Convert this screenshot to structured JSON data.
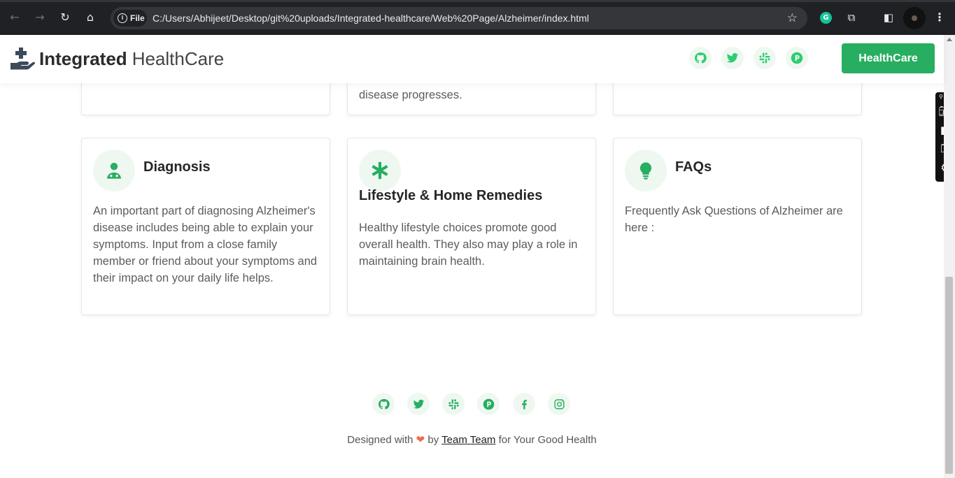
{
  "browser": {
    "file_chip": "File",
    "url": "C:/Users/Abhijeet/Desktop/git%20uploads/Integrated-healthcare/Web%20Page/Alzheimer/index.html",
    "grammarly_letter": "G"
  },
  "header": {
    "brand_bold": "Integrated",
    "brand_light": "HealthCare",
    "social_icons": [
      "github-icon",
      "twitter-icon",
      "slack-icon",
      "product-hunt-icon"
    ],
    "cta_label": "HealthCare",
    "accent_color": "#27ae60"
  },
  "top_cards": {
    "middle_tail_partial": "disease progresses."
  },
  "cards": [
    {
      "icon": "doctor-icon",
      "title": "Diagnosis",
      "text": "An important part of diagnosing Alzheimer's disease includes being able to explain your symptoms. Input from a close family member or friend about your symptoms and their impact on your daily life helps."
    },
    {
      "icon": "asterisk-icon",
      "title": "Lifestyle & Home Remedies",
      "text": "Healthy lifestyle choices promote good overall health. They also may play a role in maintaining brain health."
    },
    {
      "icon": "lightbulb-icon",
      "title": "FAQs",
      "text": "Frequently Ask Questions of Alzheimer are here :"
    }
  ],
  "footer": {
    "social_icons": [
      "github-icon",
      "twitter-icon",
      "slack-icon",
      "product-hunt-icon",
      "facebook-icon",
      "instagram-icon"
    ],
    "designed_prefix": "Designed with",
    "heart": "❤",
    "by": "by",
    "team_link": "Team Team",
    "suffix": "for Your Good Health"
  }
}
